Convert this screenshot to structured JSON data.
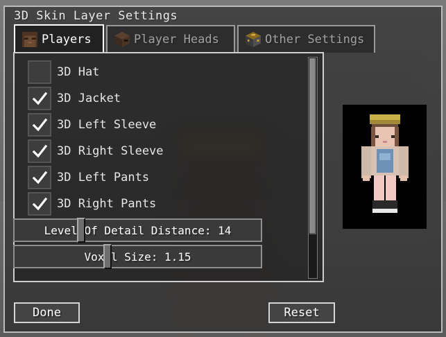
{
  "window": {
    "title": "3D Skin Layer Settings"
  },
  "tabs": [
    {
      "label": "Players",
      "icon": "player-face-icon",
      "active": true
    },
    {
      "label": "Player Heads",
      "icon": "player-head-block-icon",
      "active": false
    },
    {
      "label": "Other Settings",
      "icon": "settings-block-icon",
      "active": false
    }
  ],
  "options": [
    {
      "label": "3D Hat",
      "checked": false
    },
    {
      "label": "3D Jacket",
      "checked": true
    },
    {
      "label": "3D Left Sleeve",
      "checked": true
    },
    {
      "label": "3D Right Sleeve",
      "checked": true
    },
    {
      "label": "3D Left Pants",
      "checked": true
    },
    {
      "label": "3D Right Pants",
      "checked": true
    }
  ],
  "sliders": [
    {
      "label": "Level Of Detail Distance: 14",
      "level": 0.26
    },
    {
      "label": "Voxel Size: 1.15",
      "level": 0.37
    }
  ],
  "buttons": {
    "done": "Done",
    "reset": "Reset"
  },
  "colors": {
    "panel_border": "#bcbcbc",
    "active_tab_border": "#ffffff",
    "checkbox_bg": "#3d3d3d"
  }
}
